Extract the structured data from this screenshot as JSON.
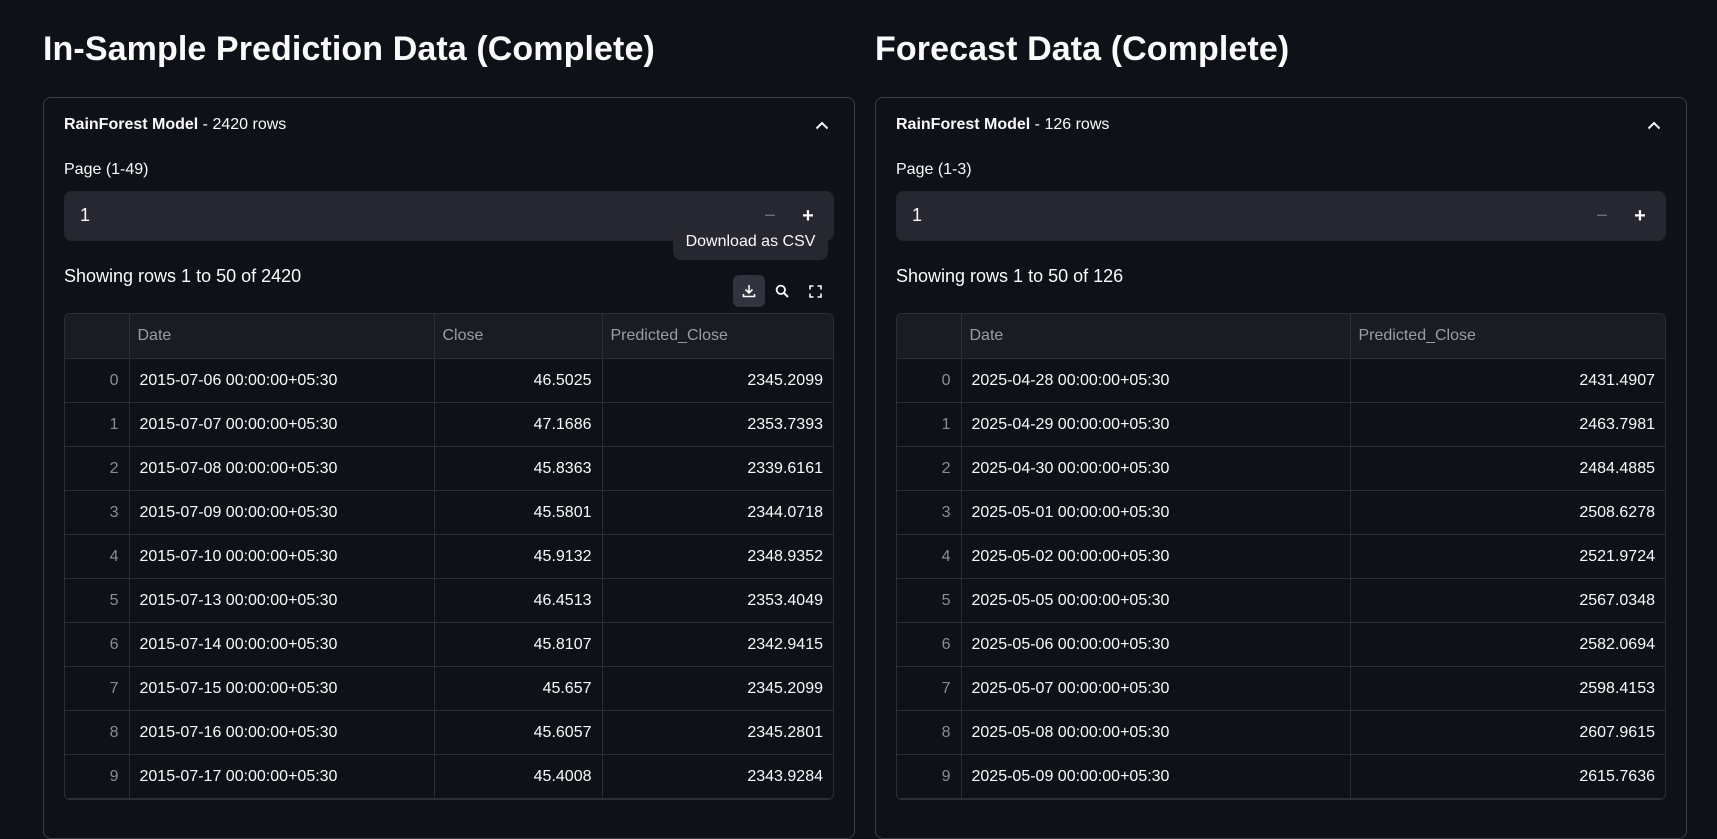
{
  "left": {
    "title": "In-Sample Prediction Data (Complete)",
    "expander": {
      "model": "RainForest Model",
      "suffix": " - 2420 rows"
    },
    "page_label": "Page (1-49)",
    "page_value": "1",
    "showing": "Showing rows 1 to 50 of 2420",
    "tooltip": "Download as CSV",
    "columns": [
      "",
      "Date",
      "Close",
      "Predicted_Close"
    ],
    "rows": [
      [
        "0",
        "2015-07-06 00:00:00+05:30",
        "46.5025",
        "2345.2099"
      ],
      [
        "1",
        "2015-07-07 00:00:00+05:30",
        "47.1686",
        "2353.7393"
      ],
      [
        "2",
        "2015-07-08 00:00:00+05:30",
        "45.8363",
        "2339.6161"
      ],
      [
        "3",
        "2015-07-09 00:00:00+05:30",
        "45.5801",
        "2344.0718"
      ],
      [
        "4",
        "2015-07-10 00:00:00+05:30",
        "45.9132",
        "2348.9352"
      ],
      [
        "5",
        "2015-07-13 00:00:00+05:30",
        "46.4513",
        "2353.4049"
      ],
      [
        "6",
        "2015-07-14 00:00:00+05:30",
        "45.8107",
        "2342.9415"
      ],
      [
        "7",
        "2015-07-15 00:00:00+05:30",
        "45.657",
        "2345.2099"
      ],
      [
        "8",
        "2015-07-16 00:00:00+05:30",
        "45.6057",
        "2345.2801"
      ],
      [
        "9",
        "2015-07-17 00:00:00+05:30",
        "45.4008",
        "2343.9284"
      ]
    ]
  },
  "right": {
    "title": "Forecast Data (Complete)",
    "expander": {
      "model": "RainForest Model",
      "suffix": " - 126 rows"
    },
    "page_label": "Page (1-3)",
    "page_value": "1",
    "showing": "Showing rows 1 to 50 of 126",
    "columns": [
      "",
      "Date",
      "Predicted_Close"
    ],
    "rows": [
      [
        "0",
        "2025-04-28 00:00:00+05:30",
        "2431.4907"
      ],
      [
        "1",
        "2025-04-29 00:00:00+05:30",
        "2463.7981"
      ],
      [
        "2",
        "2025-04-30 00:00:00+05:30",
        "2484.4885"
      ],
      [
        "3",
        "2025-05-01 00:00:00+05:30",
        "2508.6278"
      ],
      [
        "4",
        "2025-05-02 00:00:00+05:30",
        "2521.9724"
      ],
      [
        "5",
        "2025-05-05 00:00:00+05:30",
        "2567.0348"
      ],
      [
        "6",
        "2025-05-06 00:00:00+05:30",
        "2582.0694"
      ],
      [
        "7",
        "2025-05-07 00:00:00+05:30",
        "2598.4153"
      ],
      [
        "8",
        "2025-05-08 00:00:00+05:30",
        "2607.9615"
      ],
      [
        "9",
        "2025-05-09 00:00:00+05:30",
        "2615.7636"
      ]
    ]
  }
}
